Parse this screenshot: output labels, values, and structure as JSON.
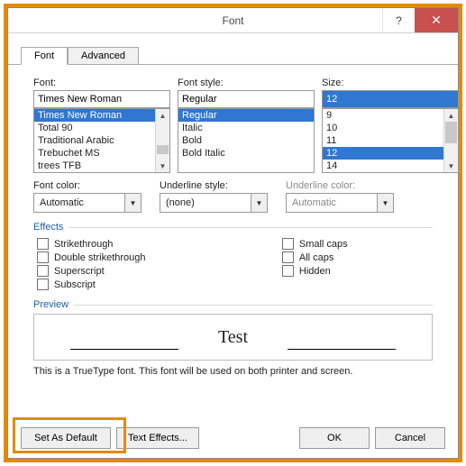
{
  "titlebar": {
    "title": "Font",
    "help": "?",
    "close": "✕"
  },
  "tabs": {
    "font": "Font",
    "advanced": "Advanced"
  },
  "labels": {
    "font": "Font:",
    "fontStyle": "Font style:",
    "size": "Size:",
    "fontColor": "Font color:",
    "underlineStyle": "Underline style:",
    "underlineColor": "Underline color:",
    "effects": "Effects",
    "preview": "Preview"
  },
  "font": {
    "input": "Times New Roman",
    "items": [
      "Times New Roman",
      "Total 90",
      "Traditional Arabic",
      "Trebuchet MS",
      "trees TFB"
    ],
    "selectedIndex": 0
  },
  "fontStyle": {
    "input": "Regular",
    "items": [
      "Regular",
      "Italic",
      "Bold",
      "Bold Italic"
    ],
    "selectedIndex": 0
  },
  "size": {
    "input": "12",
    "items": [
      "9",
      "10",
      "11",
      "12",
      "14"
    ],
    "selectedIndex": 3
  },
  "combos": {
    "fontColor": "Automatic",
    "underlineStyle": "(none)",
    "underlineColor": "Automatic"
  },
  "effects": {
    "strikethrough": "Strikethrough",
    "doubleStrike": "Double strikethrough",
    "superscript": "Superscript",
    "subscript": "Subscript",
    "smallCaps": "Small caps",
    "allCaps": "All caps",
    "hidden": "Hidden"
  },
  "preview": {
    "text": "Test"
  },
  "hint": "This is a TrueType font. This font will be used on both printer and screen.",
  "footer": {
    "setDefault": "Set As Default",
    "textEffects": "Text Effects...",
    "ok": "OK",
    "cancel": "Cancel"
  },
  "underline_prefix": "D",
  "underline_map": {
    "tabs.font": "F",
    "tabs.advanced": "v",
    "labels.font": "F",
    "labels.fontStyle": "y",
    "labels.size": "S",
    "labels.fontColor": "c",
    "labels.underlineStyle": "U",
    "labels.underlineColor": "l",
    "effects.strikethrough": "k",
    "effects.doubleStrike": "l",
    "effects.superscript": "p",
    "effects.subscript": "b",
    "effects.smallCaps": "m",
    "effects.allCaps": "A",
    "effects.hidden": "H",
    "footer.setDefault": "D",
    "footer.textEffects": "E"
  }
}
